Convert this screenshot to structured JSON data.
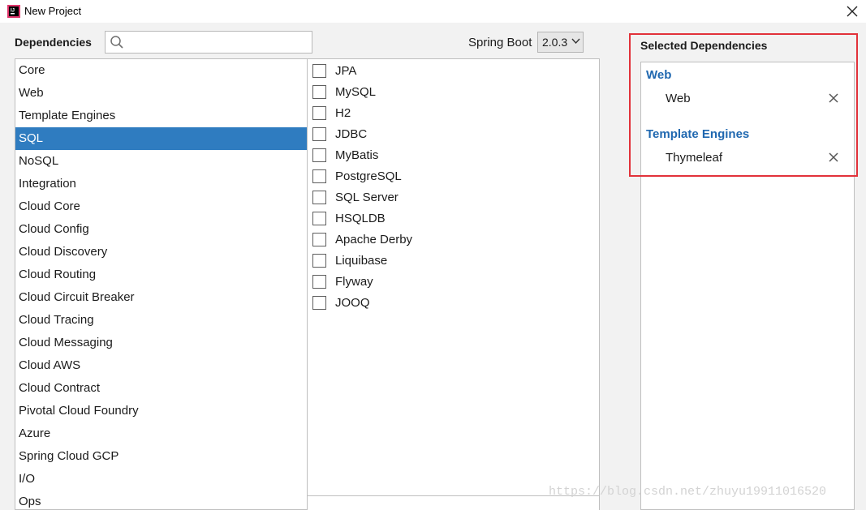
{
  "window": {
    "title": "New Project"
  },
  "dependencies_label": "Dependencies",
  "search": {
    "value": "",
    "placeholder": ""
  },
  "spring_boot": {
    "label": "Spring Boot",
    "version": "2.0.3"
  },
  "categories": [
    {
      "label": "Core",
      "selected": false
    },
    {
      "label": "Web",
      "selected": false
    },
    {
      "label": "Template Engines",
      "selected": false
    },
    {
      "label": "SQL",
      "selected": true
    },
    {
      "label": "NoSQL",
      "selected": false
    },
    {
      "label": "Integration",
      "selected": false
    },
    {
      "label": "Cloud Core",
      "selected": false
    },
    {
      "label": "Cloud Config",
      "selected": false
    },
    {
      "label": "Cloud Discovery",
      "selected": false
    },
    {
      "label": "Cloud Routing",
      "selected": false
    },
    {
      "label": "Cloud Circuit Breaker",
      "selected": false
    },
    {
      "label": "Cloud Tracing",
      "selected": false
    },
    {
      "label": "Cloud Messaging",
      "selected": false
    },
    {
      "label": "Cloud AWS",
      "selected": false
    },
    {
      "label": "Cloud Contract",
      "selected": false
    },
    {
      "label": "Pivotal Cloud Foundry",
      "selected": false
    },
    {
      "label": "Azure",
      "selected": false
    },
    {
      "label": "Spring Cloud GCP",
      "selected": false
    },
    {
      "label": "I/O",
      "selected": false
    },
    {
      "label": "Ops",
      "selected": false
    }
  ],
  "sql_dependencies": [
    {
      "label": "JPA",
      "checked": false
    },
    {
      "label": "MySQL",
      "checked": false
    },
    {
      "label": "H2",
      "checked": false
    },
    {
      "label": "JDBC",
      "checked": false
    },
    {
      "label": "MyBatis",
      "checked": false
    },
    {
      "label": "PostgreSQL",
      "checked": false
    },
    {
      "label": "SQL Server",
      "checked": false
    },
    {
      "label": "HSQLDB",
      "checked": false
    },
    {
      "label": "Apache Derby",
      "checked": false
    },
    {
      "label": "Liquibase",
      "checked": false
    },
    {
      "label": "Flyway",
      "checked": false
    },
    {
      "label": "JOOQ",
      "checked": false
    }
  ],
  "selected": {
    "title": "Selected Dependencies",
    "groups": [
      {
        "name": "Web",
        "items": [
          "Web"
        ]
      },
      {
        "name": "Template Engines",
        "items": [
          "Thymeleaf"
        ]
      }
    ]
  },
  "watermark": "https://blog.csdn.net/zhuyu19911016520",
  "colors": {
    "selection": "#2f7cc0",
    "group_title": "#2068b0",
    "highlight": "#e2323a"
  },
  "icons": [
    "app-icon",
    "close-icon",
    "search-icon",
    "chevron-down-icon",
    "remove-icon"
  ]
}
